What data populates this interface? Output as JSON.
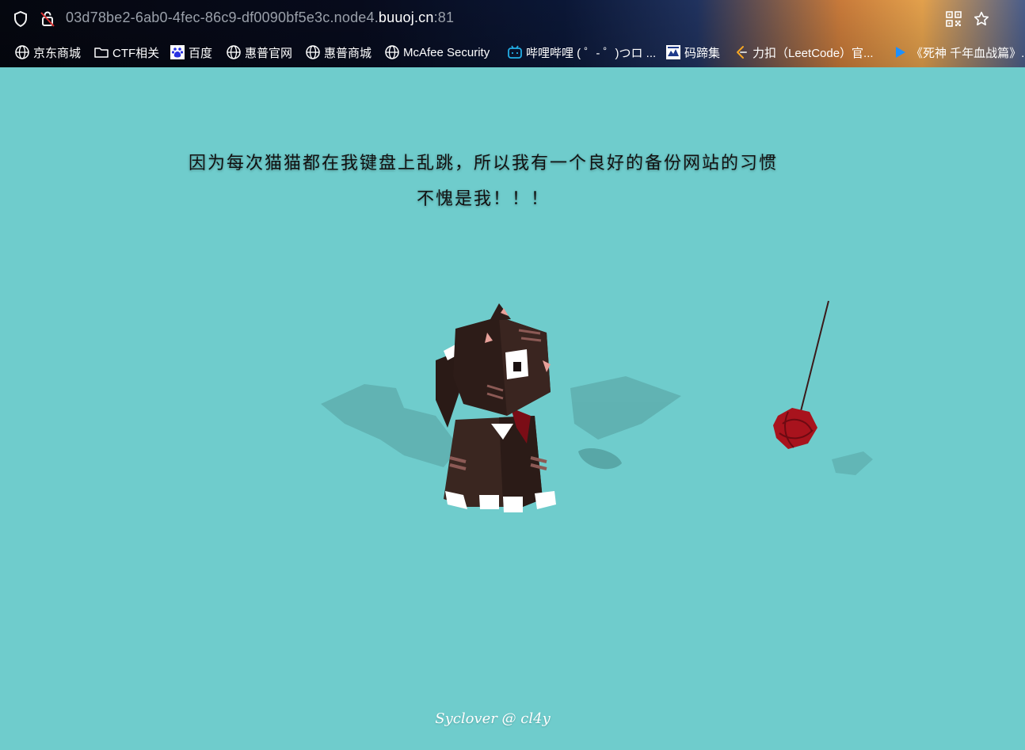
{
  "browser": {
    "url_prefix": "03d78be2-6ab0-4fec-86c9-df0090bf5e3c.node4.",
    "url_domain": "buuoj.cn",
    "url_port": ":81",
    "left_icons": [
      "shield-icon",
      "lock-broken-icon"
    ],
    "right_icons": [
      "qr-code-icon",
      "star-icon"
    ]
  },
  "bookmarks": [
    {
      "label": "京东商城",
      "icon": "globe-icon"
    },
    {
      "label": "CTF相关",
      "icon": "folder-icon"
    },
    {
      "label": "百度",
      "icon": "baidu-icon"
    },
    {
      "label": "惠普官网",
      "icon": "globe-icon"
    },
    {
      "label": "惠普商城",
      "icon": "globe-icon"
    },
    {
      "label": "McAfee Security",
      "icon": "globe-icon"
    },
    {
      "label": "哔哩哔哩 ( ゜- ゜)つロ ...",
      "icon": "bilibili-icon"
    },
    {
      "label": "码蹄集",
      "icon": "matiji-icon"
    },
    {
      "label": "力扣（LeetCode）官...",
      "icon": "leetcode-icon"
    },
    {
      "label": "《死神 千年血战篇》...",
      "icon": "play-icon"
    }
  ],
  "page": {
    "headline_line1": "因为每次猫猫都在我键盘上乱跳，所以我有一个良好的备份网站的习惯",
    "headline_line2": "不愧是我！！！",
    "signature": "Syclover @ cl4y"
  },
  "colors": {
    "background": "#6fcccc",
    "yarn": "#b0141e",
    "cat": "#3a2620"
  }
}
